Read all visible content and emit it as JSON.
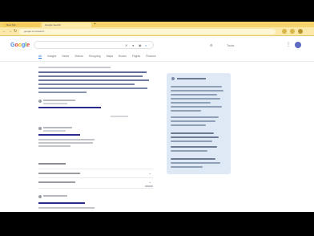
{
  "browser": {
    "tabs": [
      {
        "label": "New Tab"
      },
      {
        "label": "Google Search"
      }
    ],
    "new_tab_symbol": "+",
    "address": "google.com/search",
    "nav": {
      "back": "←",
      "forward": "→",
      "reload": "↻"
    },
    "accent_color": "#f6d36b"
  },
  "google": {
    "logo": {
      "g1": "G",
      "o1": "o",
      "o2": "o",
      "g2": "g",
      "l": "l",
      "e": "e"
    },
    "query": "",
    "filters": [
      {
        "label": "All"
      },
      {
        "label": "Images"
      },
      {
        "label": "News"
      },
      {
        "label": "Videos"
      },
      {
        "label": "Shopping"
      },
      {
        "label": "Maps"
      },
      {
        "label": "Books"
      },
      {
        "label": "Flights"
      },
      {
        "label": "Finance"
      }
    ],
    "tools_label": "Tools"
  }
}
